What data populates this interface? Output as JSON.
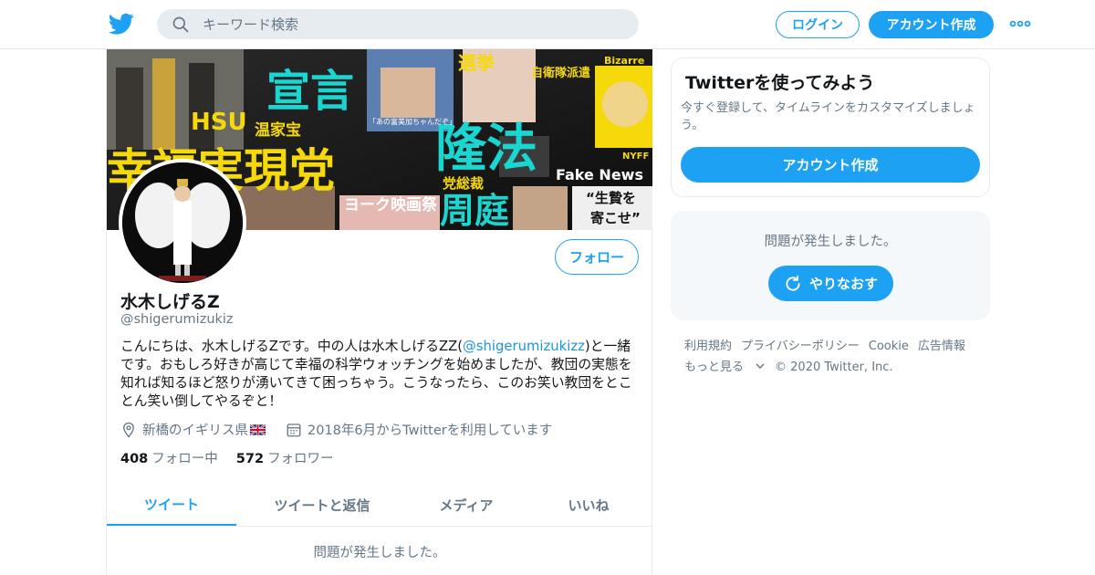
{
  "header": {
    "search_placeholder": "キーワード検索",
    "login_label": "ログイン",
    "signup_label": "アカウント作成"
  },
  "profile": {
    "banner_texts": [
      "宣言",
      "HSU",
      "温家宝",
      "幸福実現党",
      "隆法",
      "党総裁",
      "周庭",
      "選挙",
      "自衛隊派遣",
      "Bizarre",
      "Fake News",
      "NYFF",
      "ヨーク映画祭",
      "“生贄を",
      "寄こせ”",
      "「あの富美加ちゃんだぞ」"
    ],
    "follow_label": "フォロー",
    "name": "水木しげるZ",
    "handle": "@shigerumizukiz",
    "bio_part1": "こんにちは、水木しげるZです。中の人は水木しげるZZ(",
    "bio_mention": "@shigerumizukizz",
    "bio_part2": ")と一緒です。おもしろ好きが高じて幸福の科学ウォッチングを始めましたが、教団の実態を知れば知るほど怒りが湧いてきて困っちゃう。こうなったら、このお笑い教団をとことん笑い倒してやるぞと！",
    "location": "新橋のイギリス県",
    "joined": "2018年6月からTwitterを利用しています",
    "following_count": "408",
    "following_label": "フォロー中",
    "followers_count": "572",
    "followers_label": "フォロワー"
  },
  "tabs": [
    {
      "label": "ツイート",
      "active": true
    },
    {
      "label": "ツイートと返信",
      "active": false
    },
    {
      "label": "メディア",
      "active": false
    },
    {
      "label": "いいね",
      "active": false
    }
  ],
  "timeline": {
    "error_message": "問題が発生しました。"
  },
  "sidebar": {
    "card_title": "Twitterを使ってみよう",
    "card_text": "今すぐ登録して、タイムラインをカスタマイズしましょう。",
    "card_button": "アカウント作成",
    "error_message": "問題が発生しました。",
    "retry_label": "やりなおす"
  },
  "footer": {
    "links": [
      "利用規約",
      "プライバシーポリシー",
      "Cookie",
      "広告情報",
      "もっと見る"
    ],
    "copyright": "© 2020 Twitter, Inc."
  },
  "colors": {
    "accent": "#1da1f2",
    "secondary_text": "#657786",
    "banner_cyan": "#19d6d0",
    "banner_yellow": "#f5d90a"
  },
  "icons": [
    "twitter-bird-icon",
    "search-icon",
    "more-dots-icon",
    "location-pin-icon",
    "calendar-icon",
    "uk-flag-icon",
    "refresh-icon",
    "chevron-down-icon"
  ]
}
